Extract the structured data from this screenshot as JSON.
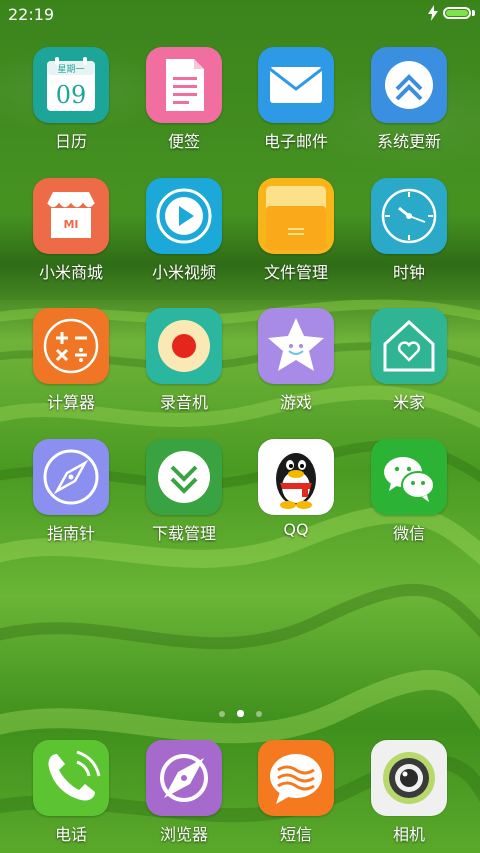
{
  "status": {
    "time": "22:19",
    "battery_level": 1.0
  },
  "pager": {
    "total": 3,
    "active_index": 1
  },
  "apps": [
    {
      "label": "日历",
      "icon": "calendar-icon",
      "color": "#1ea59a",
      "calendar_header": "星期一",
      "calendar_day": "09"
    },
    {
      "label": "便签",
      "icon": "notes-icon",
      "color": "#f06fa0"
    },
    {
      "label": "电子邮件",
      "icon": "email-icon",
      "color": "#2e9ae5"
    },
    {
      "label": "系统更新",
      "icon": "system-update-icon",
      "color": "#3a8fe0"
    },
    {
      "label": "小米商城",
      "icon": "mi-store-icon",
      "color": "#ee6b47",
      "badge": "MI"
    },
    {
      "label": "小米视频",
      "icon": "video-play-icon",
      "color": "#1ca9d9"
    },
    {
      "label": "文件管理",
      "icon": "folder-icon",
      "color": "#f7b51a"
    },
    {
      "label": "时钟",
      "icon": "clock-icon",
      "color": "#2aa9c9"
    },
    {
      "label": "计算器",
      "icon": "calculator-icon",
      "color": "#f07524"
    },
    {
      "label": "录音机",
      "icon": "recorder-icon",
      "color": "#2bb6a0"
    },
    {
      "label": "游戏",
      "icon": "game-star-icon",
      "color": "#a88be6"
    },
    {
      "label": "米家",
      "icon": "mijia-home-icon",
      "color": "#2fb594"
    },
    {
      "label": "指南针",
      "icon": "compass-icon",
      "color": "#8a8ff0"
    },
    {
      "label": "下载管理",
      "icon": "download-icon",
      "color": "#3aa341"
    },
    {
      "label": "QQ",
      "icon": "qq-penguin-icon",
      "color": "#ffffff"
    },
    {
      "label": "微信",
      "icon": "wechat-icon",
      "color": "#2cb336"
    }
  ],
  "dock": [
    {
      "label": "电话",
      "icon": "phone-icon",
      "color": "#5cc431"
    },
    {
      "label": "浏览器",
      "icon": "browser-icon",
      "color": "#a56acb"
    },
    {
      "label": "短信",
      "icon": "messages-icon",
      "color": "#f57a1f"
    },
    {
      "label": "相机",
      "icon": "camera-icon",
      "color": "#f0f0f0"
    }
  ]
}
